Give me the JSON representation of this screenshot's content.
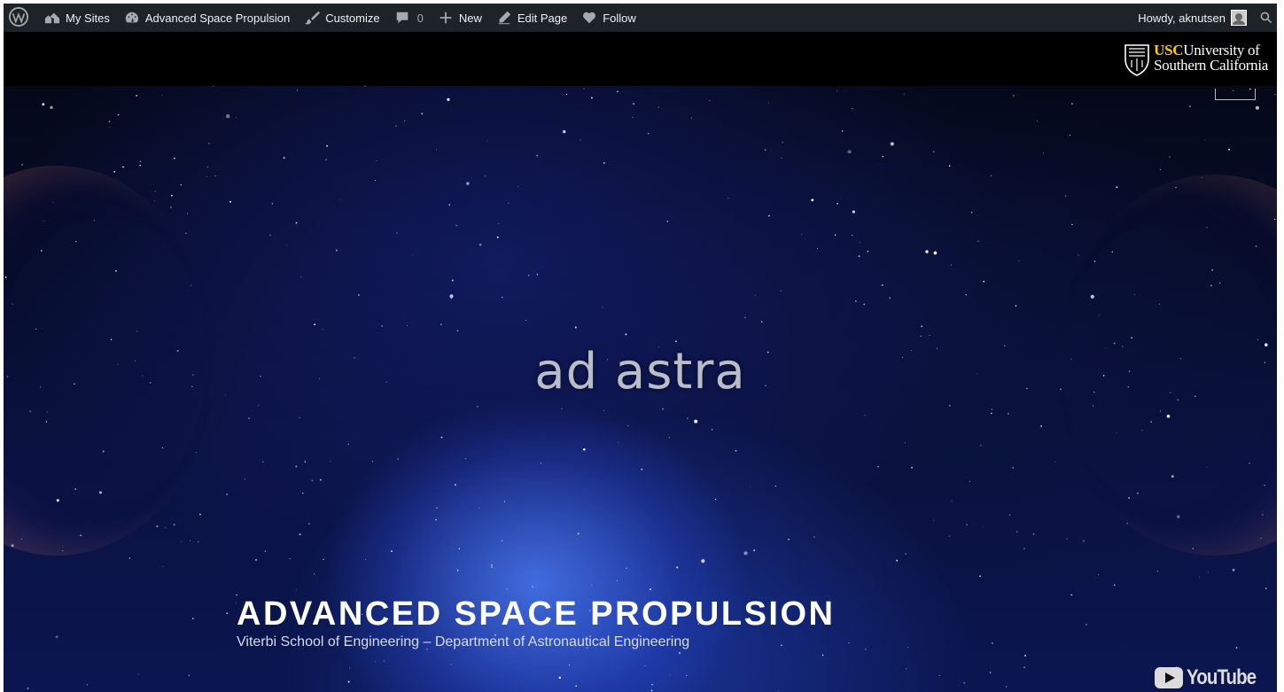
{
  "adminbar": {
    "wp_logo": "wordpress-icon",
    "items": [
      {
        "id": "my-sites",
        "label": "My Sites",
        "icon": "my-sites-icon"
      },
      {
        "id": "site-name",
        "label": "Advanced Space Propulsion",
        "icon": "dashboard-icon"
      },
      {
        "id": "customize",
        "label": "Customize",
        "icon": "paintbrush-icon"
      },
      {
        "id": "comments",
        "label": "",
        "count": "0",
        "icon": "comment-icon"
      },
      {
        "id": "new",
        "label": "New",
        "icon": "plus-icon"
      },
      {
        "id": "edit-page",
        "label": "Edit Page",
        "icon": "pencil-icon"
      },
      {
        "id": "follow",
        "label": "Follow",
        "icon": "heart-icon"
      }
    ],
    "howdy": "Howdy, aknutsen"
  },
  "header": {
    "logo_usc": "USC",
    "logo_line1": "University of",
    "logo_line2": "Southern California"
  },
  "hero": {
    "video_text": "ad astra",
    "site_title": "ADVANCED SPACE PROPULSION",
    "site_description": "Viterbi School of Engineering – Department of Astronautical Engineering",
    "youtube_label": "YouTube"
  },
  "colors": {
    "adminbar_bg": "#1d2327",
    "usc_gold": "#ffcc00",
    "page_bg": "#000000"
  }
}
